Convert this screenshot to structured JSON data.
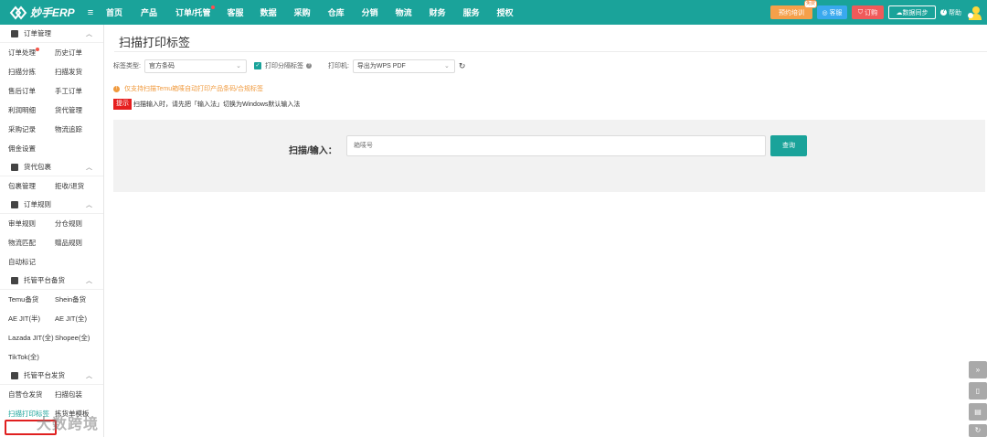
{
  "topnav": {
    "logo_text": "妙手ERP",
    "items": [
      {
        "label": "首页"
      },
      {
        "label": "产品"
      },
      {
        "label": "订单/托管"
      },
      {
        "label": "客服"
      },
      {
        "label": "数据"
      },
      {
        "label": "采购"
      },
      {
        "label": "仓库"
      },
      {
        "label": "分销"
      },
      {
        "label": "物流"
      },
      {
        "label": "财务"
      },
      {
        "label": "服务"
      },
      {
        "label": "授权"
      }
    ],
    "right": {
      "training_label": "预约培训",
      "training_badge": "免费",
      "service_label": "客服",
      "order_label": "订购",
      "sync_label": "数据同步",
      "help_label": "帮助"
    }
  },
  "sidebar": {
    "sections": [
      {
        "title": "订单管理",
        "items": [
          "订单处理",
          "历史订单",
          "扫描分拣",
          "扫描发货",
          "售后订单",
          "手工订单",
          "利润明细",
          "货代管理",
          "采购记录",
          "物流追踪",
          "佣金设置"
        ]
      },
      {
        "title": "货代包裹",
        "items": [
          "包裹管理",
          "拒收/退货"
        ]
      },
      {
        "title": "订单规则",
        "items": [
          "审单规则",
          "分仓规则",
          "物流匹配",
          "赠品规则",
          "自动标记"
        ]
      },
      {
        "title": "托管平台备货",
        "items": [
          "Temu备货",
          "Shein备货",
          "AE JIT(半)",
          "AE JIT(全)",
          "Lazada JIT(全)",
          "Shopee(全)",
          "TikTok(全)"
        ]
      },
      {
        "title": "托管平台发货",
        "items": [
          "自营仓发货",
          "扫描包装",
          "扫描打印标签",
          "拣货单模板"
        ]
      }
    ]
  },
  "main": {
    "title": "扫描打印标签",
    "label_type_label": "标签类型:",
    "label_type_value": "官方条码",
    "print_separator_label": "打印分隔标签",
    "printer_label": "打印机:",
    "printer_value": "导出为WPS PDF",
    "notice": "仅支持扫描Temu箱唛自动打印产品条码/合规标签",
    "tip_tag": "提示",
    "tip_text": "扫描输入时，请先把「输入法」切换为Windows默认输入法",
    "scan_label": "扫描/输入：",
    "scan_placeholder": "箱唛号",
    "query_button": "查询"
  },
  "watermark": "大数跨境",
  "colors": {
    "brand": "#1aa39a",
    "alert_red": "#e61f1f",
    "notice_orange": "#f09a3e"
  }
}
